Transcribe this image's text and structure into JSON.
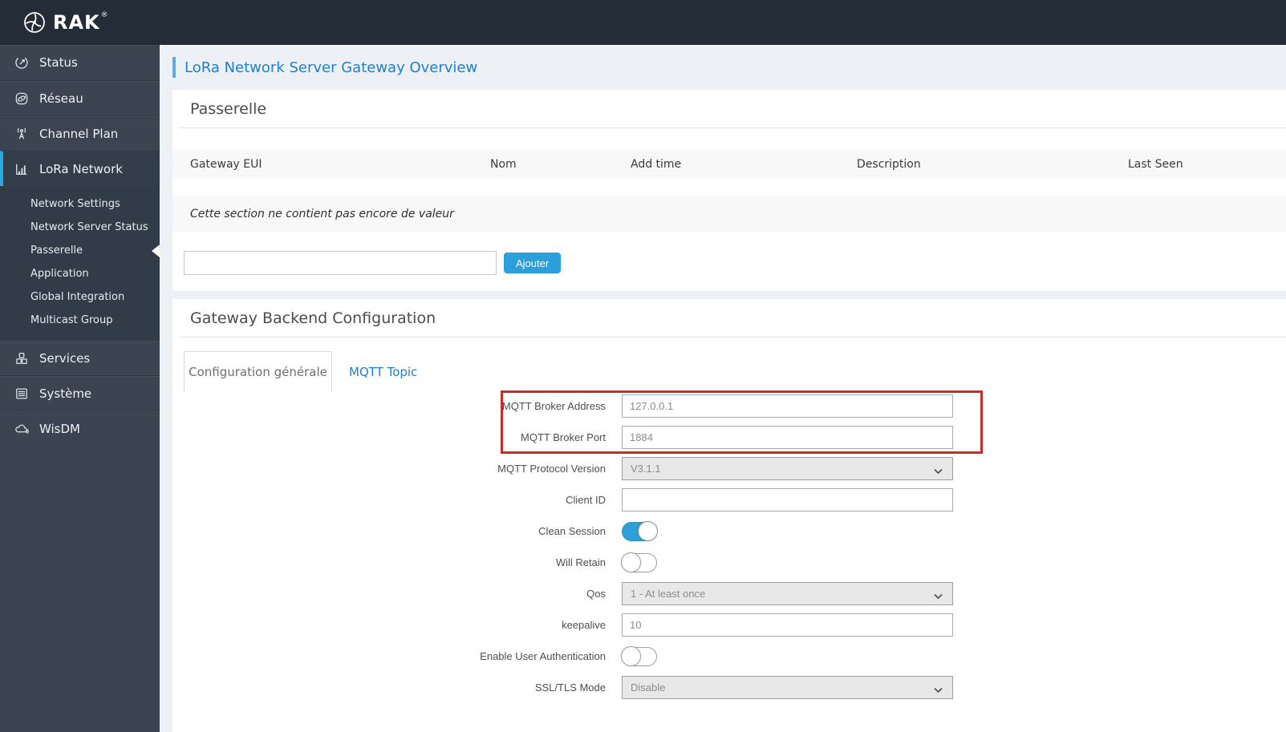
{
  "colors": {
    "accent_blue": "#1d7fd4",
    "button_blue": "#2b9fd9",
    "toggle_on_blue": "#2d9fd9",
    "highlight_red": "#cb2b24",
    "sidebar_active_blue": "#29abe2"
  },
  "brand": {
    "logo_text": "RAK",
    "registered_mark": "®"
  },
  "sidebar": {
    "items": [
      {
        "label": "Status"
      },
      {
        "label": "Réseau"
      },
      {
        "label": "Channel Plan"
      },
      {
        "label": "LoRa Network",
        "active": true
      },
      {
        "label": "Services"
      },
      {
        "label": "Système"
      },
      {
        "label": "WisDM"
      }
    ],
    "lora_subitems": [
      "Network Settings",
      "Network Server Status",
      "Passerelle",
      "Application",
      "Global Integration",
      "Multicast Group"
    ],
    "active_subitem": "Passerelle"
  },
  "page": {
    "title": "LoRa Network Server Gateway Overview"
  },
  "passerelle": {
    "heading": "Passerelle",
    "table_headers": [
      "Gateway EUI",
      "Nom",
      "Add time",
      "Description",
      "Last Seen"
    ],
    "empty_message": "Cette section ne contient pas encore de valeur",
    "add_input_value": "",
    "add_button_label": "Ajouter"
  },
  "backend": {
    "heading": "Gateway Backend Configuration",
    "tabs": [
      {
        "label": "Configuration générale",
        "active": true
      },
      {
        "label": "MQTT Topic",
        "active": false
      }
    ],
    "fields": [
      {
        "label": "MQTT Broker Address",
        "type": "text",
        "value": "127.0.0.1",
        "highlighted": true
      },
      {
        "label": "MQTT Broker Port",
        "type": "text",
        "value": "1884",
        "highlighted": true
      },
      {
        "label": "MQTT Protocol Version",
        "type": "select",
        "value": "V3.1.1"
      },
      {
        "label": "Client ID",
        "type": "text",
        "value": ""
      },
      {
        "label": "Clean Session",
        "type": "toggle",
        "state": "on"
      },
      {
        "label": "Will Retain",
        "type": "toggle",
        "state": "off"
      },
      {
        "label": "Qos",
        "type": "select",
        "value": "1 - At least once"
      },
      {
        "label": "keepalive",
        "type": "text",
        "value": "10"
      },
      {
        "label": "Enable User Authentication",
        "type": "toggle",
        "state": "off"
      },
      {
        "label": "SSL/TLS Mode",
        "type": "select",
        "value": "Disable"
      }
    ]
  }
}
